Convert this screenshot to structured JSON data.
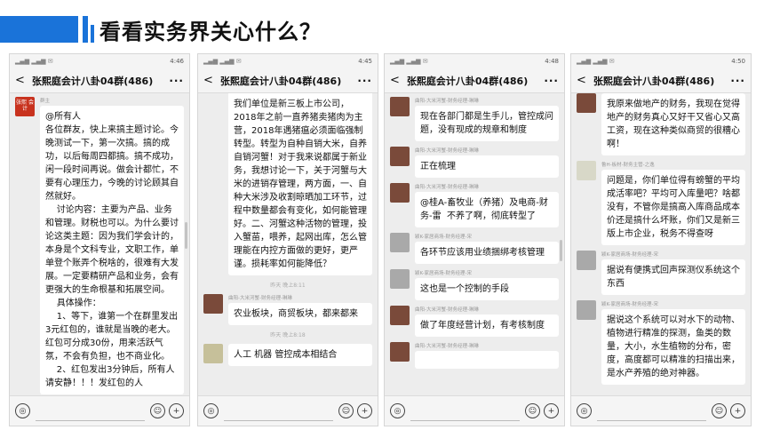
{
  "slide": {
    "title": "看看实务界关心什么？"
  },
  "common": {
    "chat_title": "张熙庭会计八卦04群(486)",
    "back_glyph": "<",
    "more_glyph": "···",
    "voice_glyph": "◎",
    "emoji_glyph": "☺",
    "plus_glyph": "+"
  },
  "phones": [
    {
      "time": "4:46",
      "messages": [
        {
          "sender": "群主",
          "avatar": "red",
          "avatar_text": "张熙\n会计",
          "text": "@所有人\n各位群友，快上来搞主题讨论。今晚测试一下，第一次搞。搞的成功，以后每周四都搞。搞不成功，闲一段时间再说。做会计都忙，不要有心理压力，今晚的讨论顾其自然就好。\n    讨论内容：主要为产品、业务和管理。财税也可以。为什么要讨论这类主题：因为我们学会计的，本身是个文科专业，文职工作，单单登个账弄个税啥的，很难有大发展。一定要精研产品和业务，会有更强大的生命根基和拓展空间。\n    具体操作：\n    1、等下，谁第一个在群里发出3元红包的，谁就是当晚的老大。红包可分成30份，用来活跃气氛，不会有负担，也不商业化。\n    2、红包发出3分钟后，所有人请安静！！！发红包的人"
        }
      ]
    },
    {
      "time": "4:45",
      "messages": [
        {
          "sender": "",
          "avatar": "none",
          "text": "我们单位是新三板上市公司，2018年之前一直养猪卖猪肉为主营，2018年遇猪瘟必须面临强制转型。转型为自种自销大米，自养自销河蟹！对于我来说都属于新业务，我想讨论一下，关于河蟹与大米的进销存管理，两方面，一、自种大米涉及收割晾晒加工环节，过程中数量都会有变化，如何能管理好。二、河蟹这种活物的管理，投入蟹苗，喂养，起网出库，怎么管理能在内控方面做的更好，更严谨。损耗率如何能降低？"
        },
        {
          "time_divider": "昨天 晚上8:11"
        },
        {
          "sender": "曲阳-大米河蟹-财务经理-琳琳",
          "avatar": "dark",
          "text": "农业板块，商贸板块，都来都来"
        },
        {
          "time_divider": "昨天 晚上8:18"
        },
        {
          "sender": "",
          "avatar": "tea",
          "text": "人工 机器 管控成本相结合"
        }
      ]
    },
    {
      "time": "4:48",
      "messages": [
        {
          "sender": "曲阳-大米河蟹-财务经理-琳琳",
          "avatar": "dark",
          "text": "现在各部门都是生手儿，管控成问题，没有现成的规章和制度"
        },
        {
          "sender": "曲阳-大米河蟹-财务经理-琳琳",
          "avatar": "dark",
          "text": "正在梳理"
        },
        {
          "sender": "曲阳-大米河蟹-财务经理-琳琳",
          "avatar": "dark",
          "text": "@桂A-畜牧业（养猪）及电商-财务-雷  不养了啊，彻底转型了"
        },
        {
          "sender": "颖K-家居商场-财务经理-宋",
          "avatar": "grey",
          "text": "各环节应该用业绩捆绑考核管理"
        },
        {
          "sender": "颖K-家居商场-财务经理-宋",
          "avatar": "grey",
          "text": "这也是一个控制的手段"
        },
        {
          "sender": "曲阳-大米河蟹-财务经理-琳琳",
          "avatar": "dark",
          "text": "做了年度经营计划，有考核制度"
        },
        {
          "sender": "曲阳-大米河蟹-财务经理-琳琳",
          "avatar": "dark",
          "text": ""
        }
      ]
    },
    {
      "time": "4:50",
      "messages": [
        {
          "sender": "",
          "avatar": "dark",
          "text": "我原来做地产的财务，我现在觉得地产的财务真心又好干又省心又高工资，现在这种类似商贸的很糟心啊！"
        },
        {
          "sender": "鲁H-板材-财务主管-之逸",
          "avatar": "light",
          "text": "问题是，你们单位得有螃蟹的平均成活率吧？平均可入库量吧？啥都没有，不管你是搞高入库商品成本价还是搞什么坏账，你们又是新三版上市企业，税务不得查呀"
        },
        {
          "sender": "颖K-家居商场-财务经理-宋",
          "avatar": "grey",
          "text": "据说有便携式回声探测仪系统这个东西"
        },
        {
          "sender": "颖K-家居商场-财务经理-宋",
          "avatar": "grey",
          "text": "据说这个系统可以对水下的动物、植物进行精准的探测，鱼类的数量，大小，水生植物的分布，密度，高度都可以精准的扫描出来，是水产养殖的绝对神器。"
        }
      ]
    }
  ]
}
